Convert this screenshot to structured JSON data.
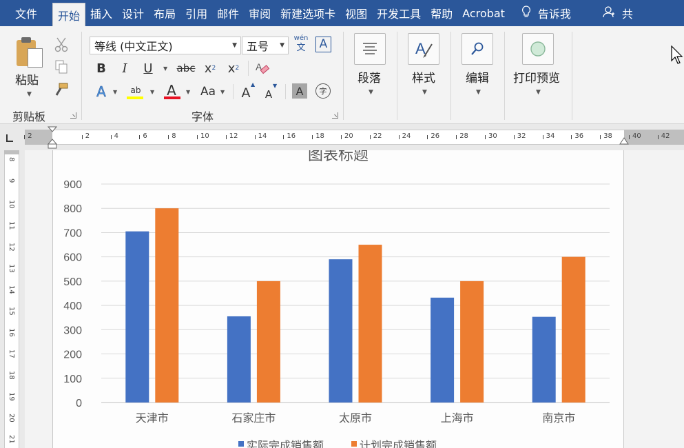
{
  "tabs": [
    {
      "label": "文件",
      "kind": "file"
    },
    {
      "label": "开始",
      "kind": "active"
    },
    {
      "label": "插入"
    },
    {
      "label": "设计"
    },
    {
      "label": "布局"
    },
    {
      "label": "引用"
    },
    {
      "label": "邮件"
    },
    {
      "label": "审阅"
    },
    {
      "label": "新建选项卡"
    },
    {
      "label": "视图"
    },
    {
      "label": "开发工具"
    },
    {
      "label": "帮助"
    },
    {
      "label": "Acrobat"
    }
  ],
  "tell_me": "告诉我",
  "share": "共",
  "clipboard": {
    "paste_label": "粘贴",
    "group_label": "剪贴板"
  },
  "font": {
    "font_name": "等线 (中文正文)",
    "font_size": "五号",
    "phonetic_top": "wén",
    "phonetic_bottom": "文",
    "border_char": "A",
    "bold": "B",
    "italic": "I",
    "underline": "U",
    "strike": "abc",
    "subscript_base": "x",
    "subscript": "2",
    "superscript_base": "x",
    "superscript": "2",
    "effects": "A",
    "highlight": "ab",
    "font_color": "A",
    "case": "Aa",
    "grow": "A",
    "shrink": "A",
    "shading": "A",
    "enclose": "字",
    "group_label": "字体",
    "highlight_color": "#ffff00",
    "font_color_value": "#e81123"
  },
  "paragraph": {
    "label": "段落"
  },
  "styles": {
    "label": "样式"
  },
  "editing": {
    "label": "编辑"
  },
  "print_preview": {
    "label": "打印预览"
  },
  "ruler": {
    "ticks": [
      "2",
      "2",
      "4",
      "6",
      "8",
      "10",
      "12",
      "14",
      "16",
      "18",
      "20",
      "22",
      "24",
      "26",
      "28",
      "30",
      "32",
      "34",
      "36",
      "38",
      "40",
      "42"
    ]
  },
  "vruler": {
    "ticks": [
      "8",
      "9",
      "10",
      "11",
      "12",
      "13",
      "14",
      "15",
      "16",
      "17",
      "18",
      "19",
      "20",
      "21"
    ]
  },
  "chart_data": {
    "type": "bar",
    "title": "图表标题",
    "categories": [
      "天津市",
      "石家庄市",
      "太原市",
      "上海市",
      "南京市"
    ],
    "series": [
      {
        "name": "实际完成销售额",
        "values": [
          705,
          355,
          590,
          432,
          353
        ],
        "color": "#4472c4"
      },
      {
        "name": "计划完成销售额",
        "values": [
          800,
          500,
          650,
          500,
          600
        ],
        "color": "#ed7d31"
      }
    ],
    "ylim": [
      0,
      900
    ],
    "yticks": [
      0,
      100,
      200,
      300,
      400,
      500,
      600,
      700,
      800,
      900
    ],
    "grid": true,
    "legend": "bottom"
  }
}
